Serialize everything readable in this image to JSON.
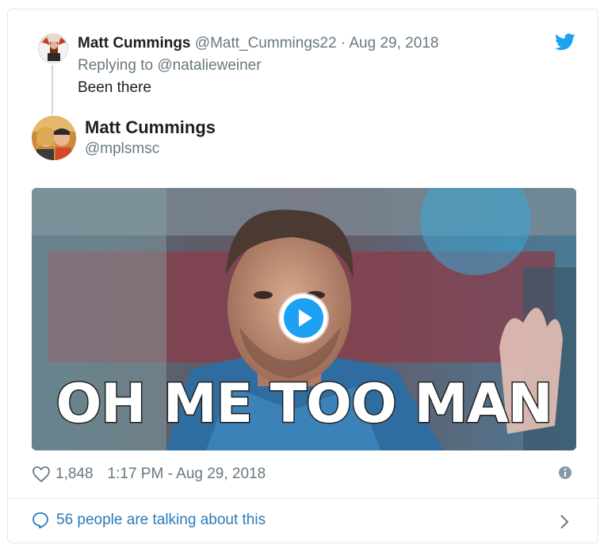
{
  "parent_tweet": {
    "author_name": "Matt Cummings",
    "author_handle": "@Matt_Cummings22",
    "separator": "·",
    "date": "Aug 29, 2018",
    "replying_to": "Replying to @natalieweiner",
    "text": "Been there"
  },
  "main_tweet": {
    "author_name": "Matt Cummings",
    "author_handle": "@mplsmsc",
    "media": {
      "type": "gif",
      "caption": "OH ME TOO MAN"
    },
    "like_count": "1,848",
    "timestamp": "1:17 PM - Aug 29, 2018"
  },
  "conversation": {
    "label": "56 people are talking about this"
  },
  "icons": {
    "brand": "twitter-bird-icon",
    "like": "heart-icon",
    "info": "info-icon",
    "conversation": "speech-bubble-icon",
    "navigate": "chevron-right-icon",
    "play": "play-icon"
  },
  "colors": {
    "brand_blue": "#1da1f2",
    "link_blue": "#2b7bb9",
    "meta_gray": "#697882",
    "text_dark": "#1c2022",
    "border": "#e1e8ed"
  }
}
